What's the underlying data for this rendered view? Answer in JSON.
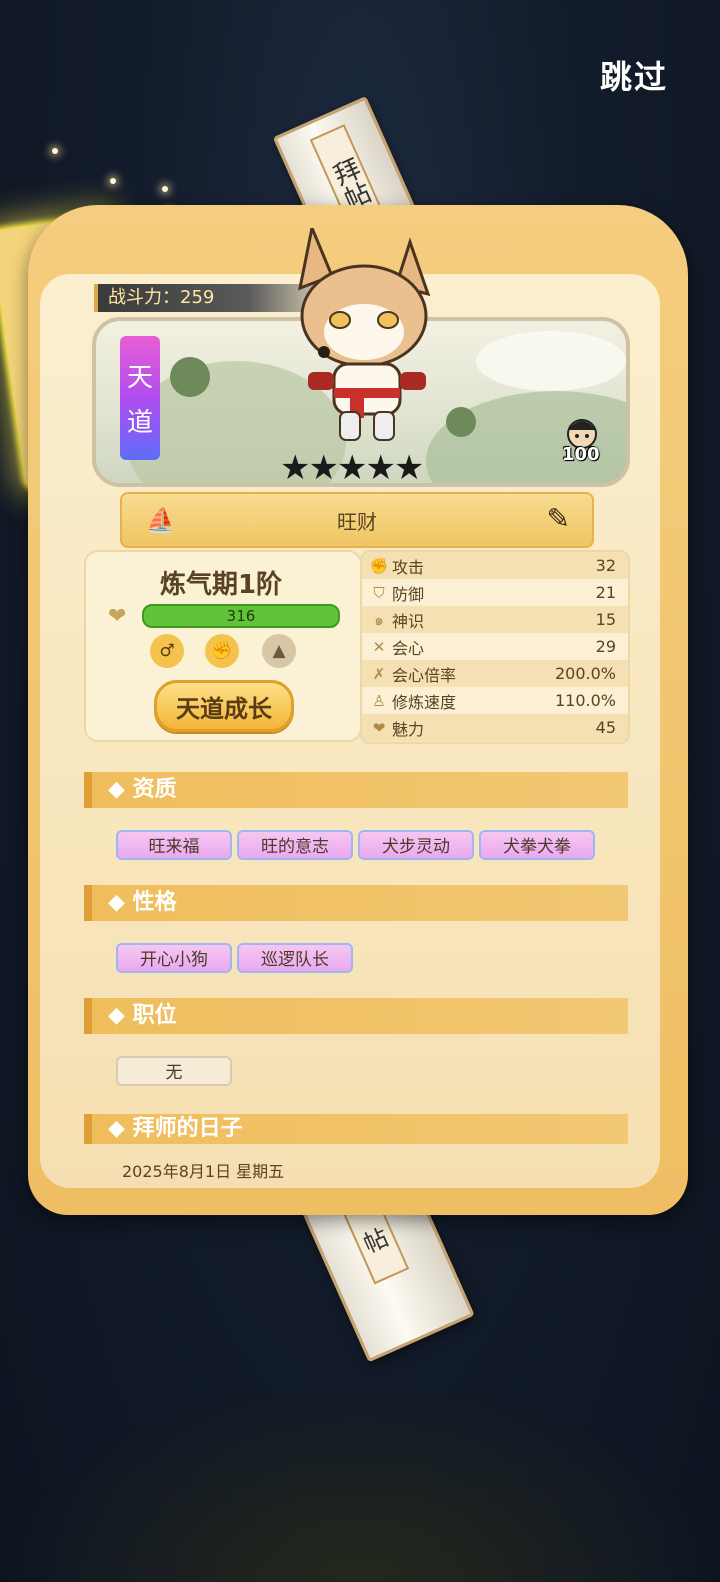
{
  "top": {
    "skip_label": "跳过"
  },
  "letter": {
    "top_text": "拜帖",
    "bottom_text": "帖"
  },
  "character": {
    "power_label": "战斗力",
    "power_value": "259",
    "rank_chars": [
      "天",
      "道"
    ],
    "stars": "★★★★★",
    "hostage_count": "100",
    "name": "旺财",
    "realm": "炼气期1阶",
    "hp": "316",
    "attribute_icons": [
      "male-icon",
      "fist-icon",
      "mountain-icon"
    ],
    "grow_button": "天道成长"
  },
  "stats": [
    {
      "icon": "fist-icon",
      "label": "攻击",
      "value": "32"
    },
    {
      "icon": "shield-icon",
      "label": "防御",
      "value": "21"
    },
    {
      "icon": "spirit-icon",
      "label": "神识",
      "value": "15"
    },
    {
      "icon": "crossed-swords-icon",
      "label": "会心",
      "value": "29"
    },
    {
      "icon": "crit-multiplier-icon",
      "label": "会心倍率",
      "value": "200.0%"
    },
    {
      "icon": "meditate-icon",
      "label": "修炼速度",
      "value": "110.0%"
    },
    {
      "icon": "heart-icon",
      "label": "魅力",
      "value": "45"
    }
  ],
  "sections": {
    "aptitude": {
      "title": "◆ 资质",
      "tags": [
        "旺来福",
        "旺的意志",
        "犬步灵动",
        "犬拳犬拳"
      ]
    },
    "personality": {
      "title": "◆ 性格",
      "tags": [
        "开心小狗",
        "巡逻队长"
      ]
    },
    "position": {
      "title": "◆ 职位",
      "tags": [
        "无"
      ]
    },
    "apprentice_day": {
      "title": "◆ 拜师的日子",
      "date": "2025年8月1日 星期五"
    }
  },
  "colors": {
    "card": "#f0c563",
    "hp_bar": "#5fc43a",
    "rank_gradient_top": "#e95fd5",
    "rank_gradient_bottom": "#5e6cf8"
  }
}
